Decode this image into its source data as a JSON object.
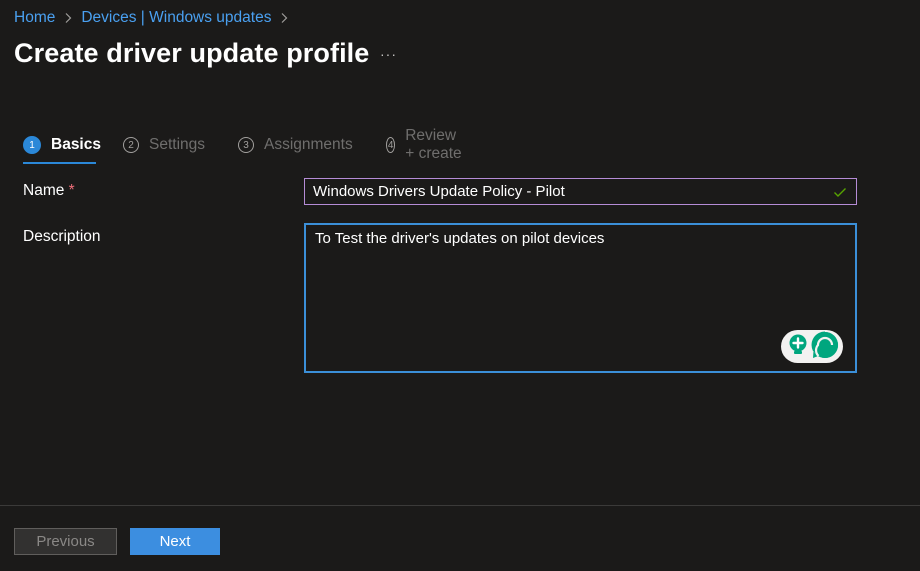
{
  "breadcrumb": {
    "items": [
      "Home",
      "Devices | Windows updates"
    ]
  },
  "page": {
    "title": "Create driver update profile",
    "more_label": "···"
  },
  "wizard": {
    "steps": [
      {
        "number": "1",
        "label": "Basics",
        "active": true
      },
      {
        "number": "2",
        "label": "Settings",
        "active": false
      },
      {
        "number": "3",
        "label": "Assignments",
        "active": false
      },
      {
        "number": "4",
        "label": "Review + create",
        "active": false
      }
    ]
  },
  "form": {
    "name": {
      "label": "Name",
      "required_marker": "*",
      "value": "Windows Drivers Update Policy - Pilot",
      "valid": true
    },
    "description": {
      "label": "Description",
      "value": "To Test the driver's updates on pilot devices"
    }
  },
  "footer": {
    "previous_label": "Previous",
    "next_label": "Next",
    "previous_disabled": true
  },
  "colors": {
    "background": "#1b1a19",
    "accent": "#2b88d8",
    "link": "#4aa0f0",
    "valid_check": "#57a300",
    "required": "#f1707b",
    "assist_green": "#00a67e"
  },
  "icons": {
    "breadcrumb_separator": "chevron-right-icon",
    "name_valid": "checkmark-icon",
    "assist": [
      "lightbulb-icon",
      "chat-bubble-icon"
    ]
  }
}
